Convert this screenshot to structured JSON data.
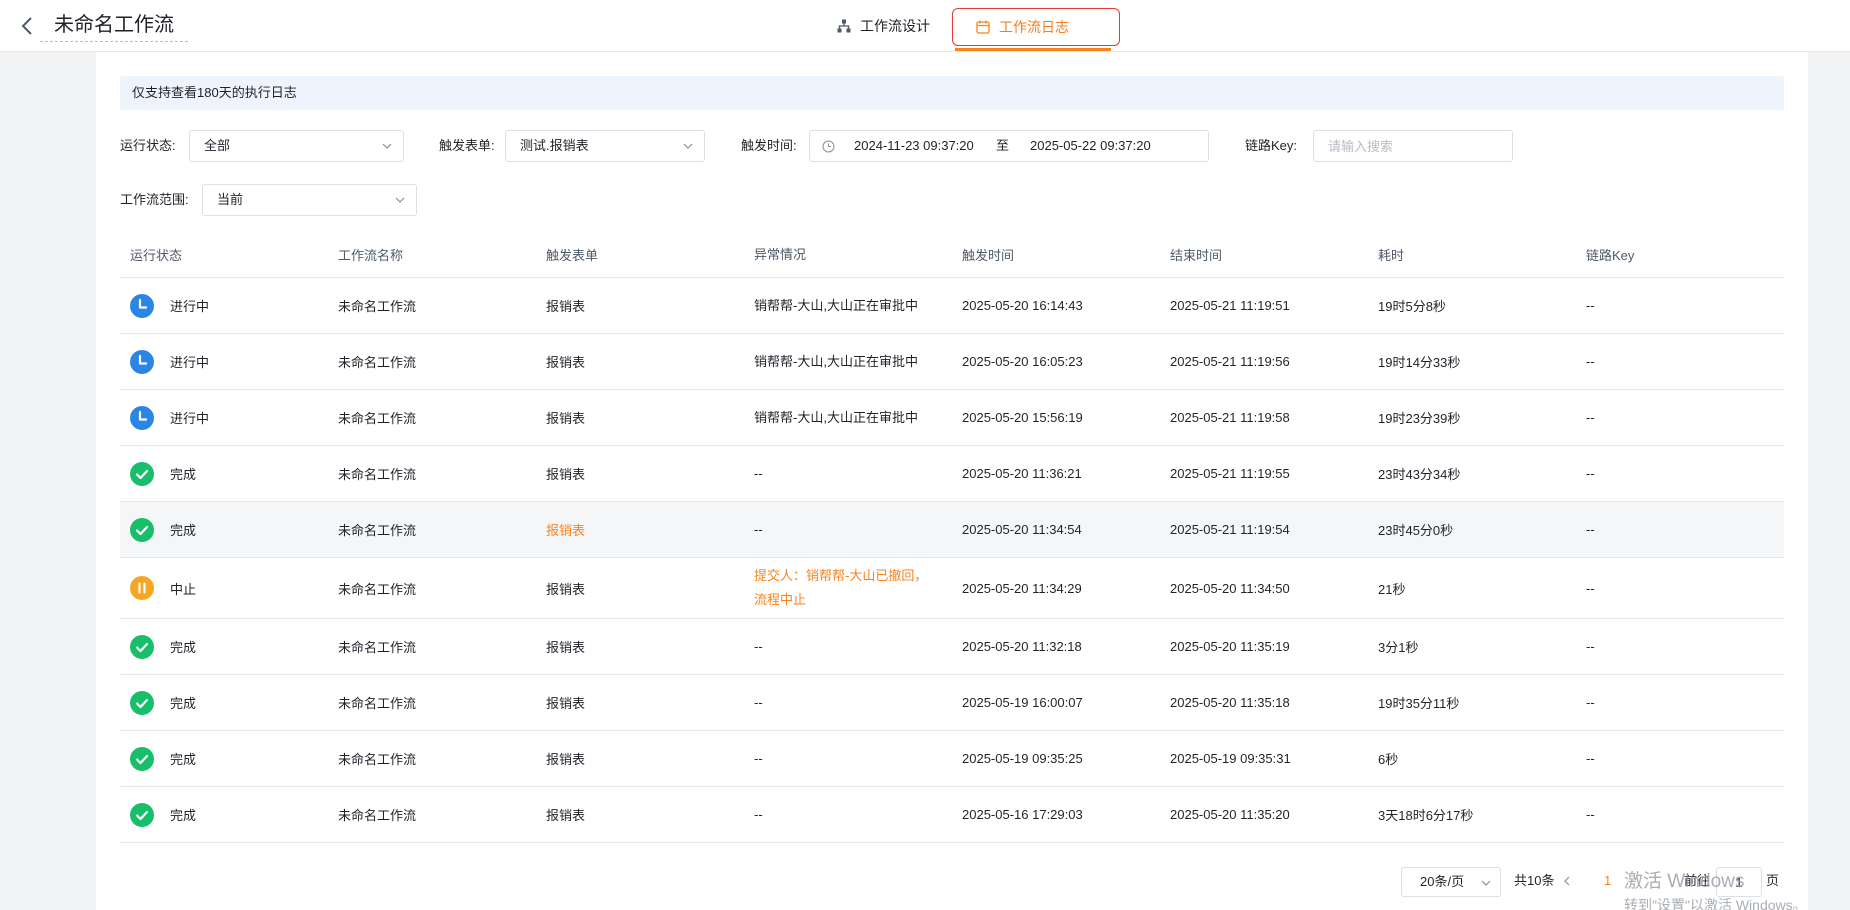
{
  "header": {
    "title": "未命名工作流",
    "tabs": [
      {
        "label": "工作流设计",
        "icon": "sitemap-icon"
      },
      {
        "label": "工作流日志",
        "icon": "calendar-icon",
        "active": true
      }
    ]
  },
  "notice": "仅支持查看180天的执行日志",
  "filters": {
    "run_status": {
      "label": "运行状态:",
      "value": "全部"
    },
    "trigger_form": {
      "label": "触发表单:",
      "value": "测试.报销表"
    },
    "trigger_time": {
      "label": "触发时间:",
      "start": "2024-11-23 09:37:20",
      "separator": "至",
      "end": "2025-05-22 09:37:20"
    },
    "trace_key": {
      "label": "链路Key:",
      "placeholder": "请输入搜索"
    },
    "workflow_scope": {
      "label": "工作流范围:",
      "value": "当前"
    }
  },
  "table": {
    "headers": [
      "运行状态",
      "工作流名称",
      "触发表单",
      "异常情况",
      "触发时间",
      "结束时间",
      "耗时",
      "链路Key"
    ],
    "rows": [
      {
        "status": "进行中",
        "status_type": "running",
        "name": "未命名工作流",
        "form": "报销表",
        "exception": "销帮帮-大山,大山正在审批中",
        "trigger": "2025-05-20 16:14:43",
        "end": "2025-05-21 11:19:51",
        "duration": "19时5分8秒",
        "key": "--"
      },
      {
        "status": "进行中",
        "status_type": "running",
        "name": "未命名工作流",
        "form": "报销表",
        "exception": "销帮帮-大山,大山正在审批中",
        "trigger": "2025-05-20 16:05:23",
        "end": "2025-05-21 11:19:56",
        "duration": "19时14分33秒",
        "key": "--"
      },
      {
        "status": "进行中",
        "status_type": "running",
        "name": "未命名工作流",
        "form": "报销表",
        "exception": "销帮帮-大山,大山正在审批中",
        "trigger": "2025-05-20 15:56:19",
        "end": "2025-05-21 11:19:58",
        "duration": "19时23分39秒",
        "key": "--"
      },
      {
        "status": "完成",
        "status_type": "done",
        "name": "未命名工作流",
        "form": "报销表",
        "exception": "--",
        "trigger": "2025-05-20 11:36:21",
        "end": "2025-05-21 11:19:55",
        "duration": "23时43分34秒",
        "key": "--"
      },
      {
        "status": "完成",
        "status_type": "done",
        "name": "未命名工作流",
        "form": "报销表",
        "exception": "--",
        "trigger": "2025-05-20 11:34:54",
        "end": "2025-05-21 11:19:54",
        "duration": "23时45分0秒",
        "key": "--"
      },
      {
        "status": "中止",
        "status_type": "stopped",
        "name": "未命名工作流",
        "form": "报销表",
        "exception": "提交人：销帮帮-大山已撤回，流程中止",
        "trigger": "2025-05-20 11:34:29",
        "end": "2025-05-20 11:34:50",
        "duration": "21秒",
        "key": "--"
      },
      {
        "status": "完成",
        "status_type": "done",
        "name": "未命名工作流",
        "form": "报销表",
        "exception": "--",
        "trigger": "2025-05-20 11:32:18",
        "end": "2025-05-20 11:35:19",
        "duration": "3分1秒",
        "key": "--"
      },
      {
        "status": "完成",
        "status_type": "done",
        "name": "未命名工作流",
        "form": "报销表",
        "exception": "--",
        "trigger": "2025-05-19 16:00:07",
        "end": "2025-05-20 11:35:18",
        "duration": "19时35分11秒",
        "key": "--"
      },
      {
        "status": "完成",
        "status_type": "done",
        "name": "未命名工作流",
        "form": "报销表",
        "exception": "--",
        "trigger": "2025-05-19 09:35:25",
        "end": "2025-05-19 09:35:31",
        "duration": "6秒",
        "key": "--"
      },
      {
        "status": "完成",
        "status_type": "done",
        "name": "未命名工作流",
        "form": "报销表",
        "exception": "--",
        "trigger": "2025-05-16 17:29:03",
        "end": "2025-05-20 11:35:20",
        "duration": "3天18时6分17秒",
        "key": "--"
      }
    ]
  },
  "pagination": {
    "page_size": "20条/页",
    "total": "共10条",
    "current_page": "1",
    "goto_label": "前往",
    "goto_value": "1",
    "page_unit": "页"
  },
  "watermark": {
    "line1": "激活 Windows",
    "line2": "转到\"设置\"以激活 Windows。"
  },
  "colors": {
    "accent": "#f7831f",
    "running": "#2b85e4",
    "done": "#19be6b",
    "stopped": "#f5a623"
  }
}
